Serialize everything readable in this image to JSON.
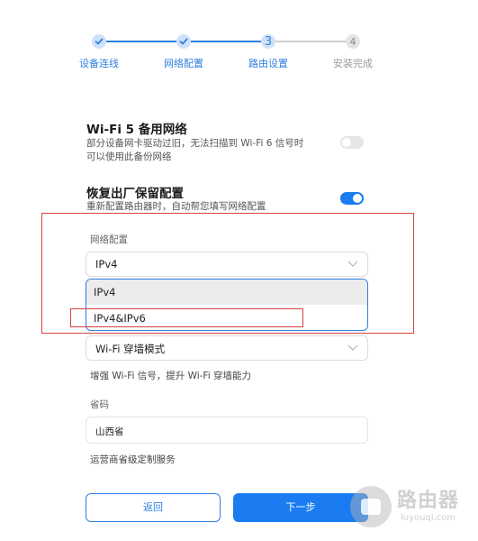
{
  "stepper": {
    "steps": [
      {
        "label": "设备连线",
        "state": "done",
        "marker": ""
      },
      {
        "label": "网络配置",
        "state": "done",
        "marker": ""
      },
      {
        "label": "路由设置",
        "state": "active",
        "marker": "3"
      },
      {
        "label": "安装完成",
        "state": "todo",
        "marker": "4"
      }
    ]
  },
  "wifi5_backup": {
    "title": "Wi-Fi 5 备用网络",
    "desc_line1": "部分设备网卡驱动过旧，无法扫描到 Wi-Fi 6 信号时",
    "desc_line2": "可以使用此备份网络",
    "enabled": false
  },
  "factory_reset_keep": {
    "title": "恢复出厂保留配置",
    "desc": "重新配置路由器时，自动帮您填写网络配置",
    "enabled": true
  },
  "network_config": {
    "label": "网络配置",
    "selected": "IPv4",
    "options": [
      "IPv4",
      "IPv4&IPv6"
    ]
  },
  "wifi_mode": {
    "selected": "Wi-Fi 穿墙模式",
    "hint": "增强 Wi-Fi 信号，提升 Wi-Fi 穿墙能力"
  },
  "province": {
    "label": "省码",
    "value": "山西省",
    "hint": "运营商省级定制服务"
  },
  "buttons": {
    "back": "返回",
    "next": "下一步"
  },
  "watermark": {
    "title": "路由器",
    "sub": "luyouqi.com"
  },
  "colors": {
    "accent": "#1a7cf0",
    "annotation": "#d84040"
  }
}
